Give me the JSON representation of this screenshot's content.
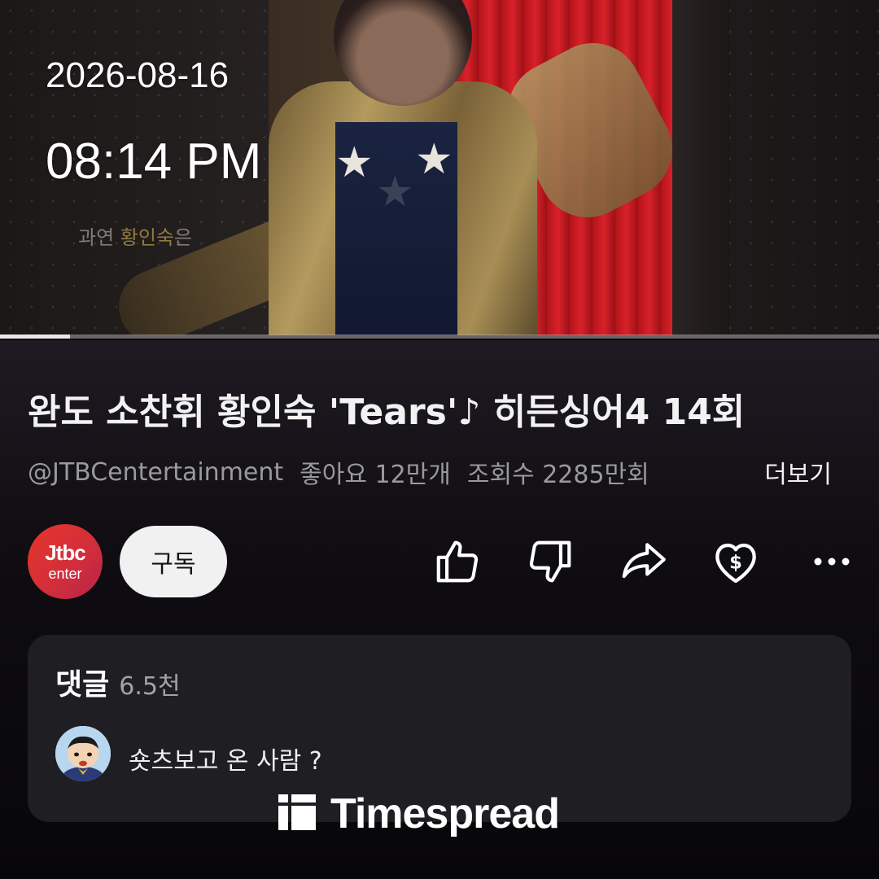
{
  "overlay": {
    "date": "2026-08-16",
    "time": "08:14 PM"
  },
  "video": {
    "subtitle_prefix": "과연 ",
    "subtitle_highlight": "황인숙",
    "subtitle_suffix": "은",
    "progress_fraction": 0.08
  },
  "title": "완도 소찬휘 황인숙 'Tears'♪ 히든싱어4 14회",
  "meta": {
    "channel": "@JTBCentertainment",
    "likes": "좋아요 12만개",
    "views": "조회수 2285만회",
    "more": "더보기"
  },
  "channel": {
    "logo_line1": "Jtbc",
    "logo_line2": "enter",
    "subscribe_label": "구독"
  },
  "actions": [
    "like-icon",
    "dislike-icon",
    "share-icon",
    "thanks-icon",
    "more-icon"
  ],
  "comments": {
    "label": "댓글",
    "count": "6.5천",
    "top_comment": "숏츠보고 온 사람 ?"
  },
  "watermark": {
    "brand": "Timespread",
    "icon": "timespread-logo-icon"
  },
  "colors": {
    "background": "#0b0a0c",
    "subscribe_bg": "#f1f1f1",
    "logo_red": "#e6362a",
    "card_bg": "#1f1e22"
  }
}
